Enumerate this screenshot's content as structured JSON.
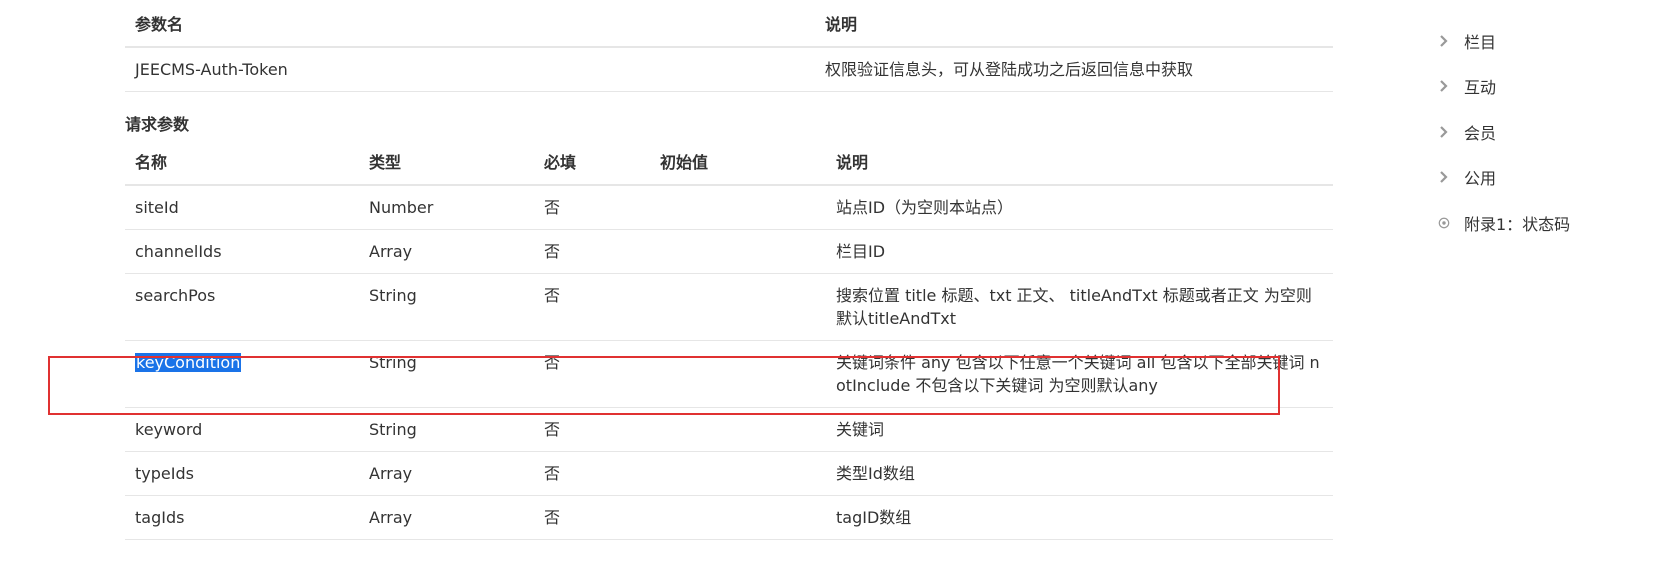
{
  "header_params": {
    "columns": [
      "参数名",
      "说明"
    ],
    "rows": [
      {
        "name": "JEECMS-Auth-Token",
        "desc": "权限验证信息头，可从登陆成功之后返回信息中获取"
      }
    ]
  },
  "request_params": {
    "title": "请求参数",
    "columns": [
      "名称",
      "类型",
      "必填",
      "初始值",
      "说明"
    ],
    "rows": [
      {
        "name": "siteId",
        "type": "Number",
        "required": "否",
        "default": "",
        "desc": "站点ID（为空则本站点）"
      },
      {
        "name": "channelIds",
        "type": "Array",
        "required": "否",
        "default": "",
        "desc": "栏目ID"
      },
      {
        "name": "searchPos",
        "type": "String",
        "required": "否",
        "default": "",
        "desc": "搜索位置 title 标题、txt 正文、 titleAndTxt 标题或者正文 为空则默认titleAndTxt"
      },
      {
        "name": "keyCondition",
        "type": "String",
        "required": "否",
        "default": "",
        "desc": "关键词条件 any 包含以下任意一个关键词 all 包含以下全部关键词 notInclude 不包含以下关键词 为空则默认any"
      },
      {
        "name": "keyword",
        "type": "String",
        "required": "否",
        "default": "",
        "desc": "关键词"
      },
      {
        "name": "typeIds",
        "type": "Array",
        "required": "否",
        "default": "",
        "desc": "类型Id数组"
      },
      {
        "name": "tagIds",
        "type": "Array",
        "required": "否",
        "default": "",
        "desc": "tagID数组"
      }
    ]
  },
  "toc": {
    "items": [
      {
        "label": "栏目",
        "icon": "chevron-right-icon"
      },
      {
        "label": "互动",
        "icon": "chevron-right-icon"
      },
      {
        "label": "会员",
        "icon": "chevron-right-icon"
      },
      {
        "label": "公用",
        "icon": "chevron-right-icon"
      },
      {
        "label": "附录1：状态码",
        "icon": "target-circle-icon"
      }
    ]
  },
  "colors": {
    "highlight_border": "#e03131",
    "selection": "#1a73e8",
    "divider": "#e6e6e6"
  }
}
